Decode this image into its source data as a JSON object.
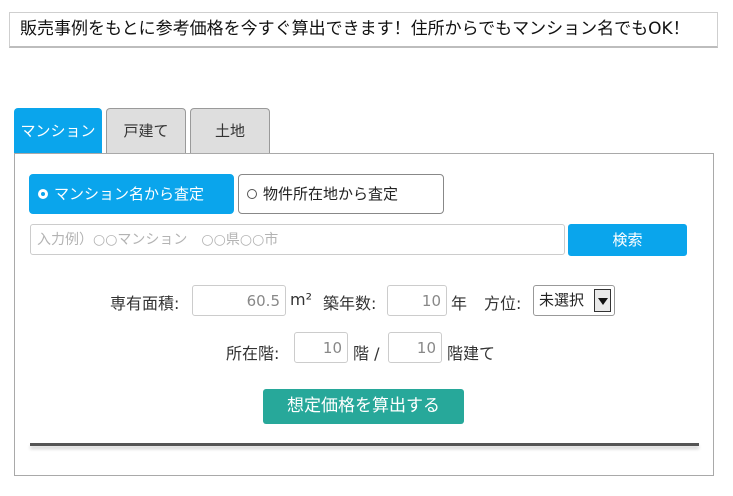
{
  "banner": {
    "text": "販売事例をもとに参考価格を今すぐ算出できます！住所からでもマンション名でもOK！"
  },
  "tabs": [
    {
      "label": "マンション",
      "active": true
    },
    {
      "label": "戸建て",
      "active": false
    },
    {
      "label": "土地",
      "active": false
    }
  ],
  "modes": [
    {
      "label": "マンション名から査定",
      "selected": true
    },
    {
      "label": "物件所在地から査定",
      "selected": false
    }
  ],
  "search": {
    "placeholder": "入力例）○○マンション　○○県○○市",
    "button_label": "検索"
  },
  "form": {
    "area_label": "専有面積:",
    "area_value": "60.5",
    "area_unit": "m²",
    "age_label": "築年数:",
    "age_value": "10",
    "age_unit": "年",
    "direction_label": "方位:",
    "direction_value": "未選択",
    "floor_label": "所在階:",
    "floor_value": "10",
    "floor_unit": "階 /",
    "total_floors_value": "10",
    "total_floors_unit": "階建て"
  },
  "calculate_button": "想定価格を算出する",
  "colors": {
    "accent_blue": "#0aa5ec",
    "accent_green": "#27a89a",
    "tab_inactive": "#dedede"
  }
}
